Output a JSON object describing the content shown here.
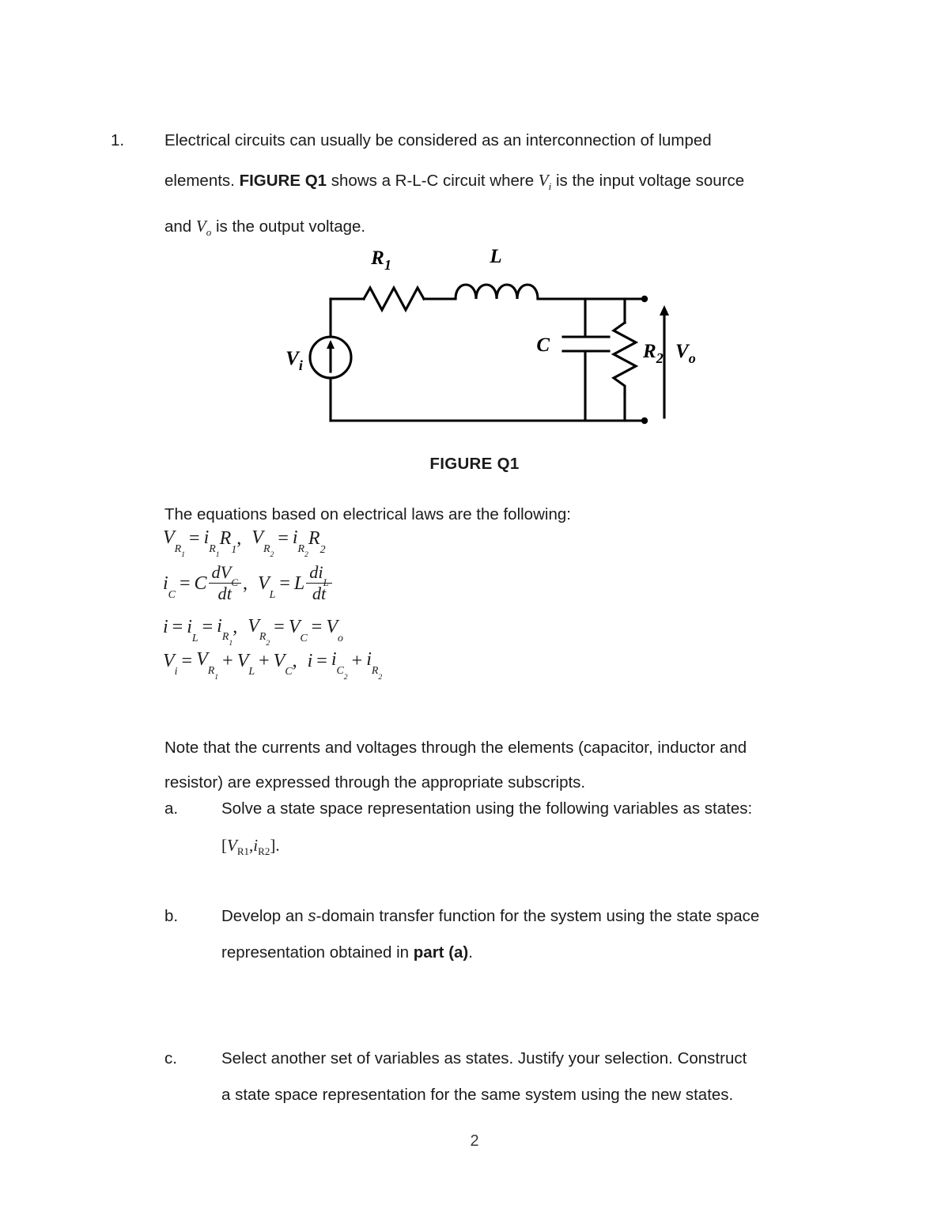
{
  "question": {
    "number": "1.",
    "line1": "Electrical circuits can usually be considered as an interconnection of lumped",
    "line2_pre": "elements. ",
    "line2_bold": "FIGURE Q1",
    "line2_mid": " shows a R-L-C circuit where ",
    "line2_var": "V",
    "line2_var_sub": "i",
    "line2_post": " is the input voltage source",
    "line3_pre": "and ",
    "line3_var": "V",
    "line3_var_sub": "o",
    "line3_post": " is the output voltage."
  },
  "figure": {
    "caption": "FIGURE Q1",
    "labels": {
      "source": "V",
      "source_sub": "i",
      "resistor1": "R",
      "resistor1_sub": "1",
      "inductor": "L",
      "capacitor": "C",
      "resistor2": "R",
      "resistor2_sub": "2",
      "output": "V",
      "output_sub": "o"
    }
  },
  "equations": {
    "intro": "The equations based on electrical laws are the following:",
    "eq1": {
      "lhs1_v": "V",
      "lhs1_sub": "R",
      "lhs1_subsub": "1",
      "eq": "=",
      "rhs1_i": "i",
      "rhs1_sub": "R",
      "rhs1_subsub": "1",
      "rhs1_r": "R",
      "rhs1_r_sub": "1",
      "comma": ",",
      "lhs2_v": "V",
      "lhs2_sub": "R",
      "lhs2_subsub": "2",
      "rhs2_i": "i",
      "rhs2_sub": "R",
      "rhs2_subsub": "2",
      "rhs2_r": "R",
      "rhs2_r_sub": "2"
    },
    "eq2": {
      "ic": "i",
      "ic_sub": "C",
      "eq": "=",
      "c": "C",
      "num1": "dV",
      "num1_sub": "C",
      "den1": "dt",
      "comma": ",",
      "vl": "V",
      "vl_sub": "L",
      "l": "L",
      "num2": "di",
      "num2_sub": "L",
      "den2": "dt"
    },
    "eq3": {
      "i": "i",
      "il": "i",
      "il_sub": "L",
      "ir1": "i",
      "ir1_sub": "R",
      "ir1_subsub": "1",
      "comma": ",",
      "vr2": "V",
      "vr2_sub": "R",
      "vr2_subsub": "2",
      "vc": "V",
      "vc_sub": "C",
      "vo": "V",
      "vo_sub": "o"
    },
    "eq4": {
      "vi": "V",
      "vi_sub": "i",
      "vr1": "V",
      "vr1_sub": "R",
      "vr1_subsub": "1",
      "vl": "V",
      "vl_sub": "L",
      "vc": "V",
      "vc_sub": "C",
      "comma": ",",
      "i": "i",
      "ic2": "i",
      "ic2_sub": "C",
      "ic2_subsub": "2",
      "ir2": "i",
      "ir2_sub": "R",
      "ir2_subsub": "2",
      "plus": "+",
      "eqsign": "="
    }
  },
  "note": {
    "line1": "Note that the currents and voltages through the elements (capacitor, inductor and",
    "line2": "resistor) are expressed through the appropriate subscripts."
  },
  "parts": {
    "a": {
      "label": "a.",
      "line1": "Solve a state space representation using the following variables as states:",
      "states_open": "[",
      "states_v": "V",
      "states_v_sub": "R",
      "states_v_subsub": "1",
      "states_comma": ",",
      "states_i": "i",
      "states_i_sub": "R",
      "states_i_subsub": "2",
      "states_close": "].",
      "states_plain": "[VR1,iR2]."
    },
    "b": {
      "label": "b.",
      "line1_pre": "Develop an ",
      "line1_italic": "s",
      "line1_post": "-domain transfer function for the system using the state space",
      "line2_pre": "representation obtained in ",
      "line2_bold": "part (a)",
      "line2_post": "."
    },
    "c": {
      "label": "c.",
      "line1": "Select another set of variables as states. Justify your selection. Construct",
      "line2": "a state space representation for the same system using the new states."
    }
  },
  "footer": {
    "page_number": "2"
  },
  "colors": {
    "text": "#1b1b1b",
    "stroke": "#000000",
    "background": "#ffffff"
  }
}
